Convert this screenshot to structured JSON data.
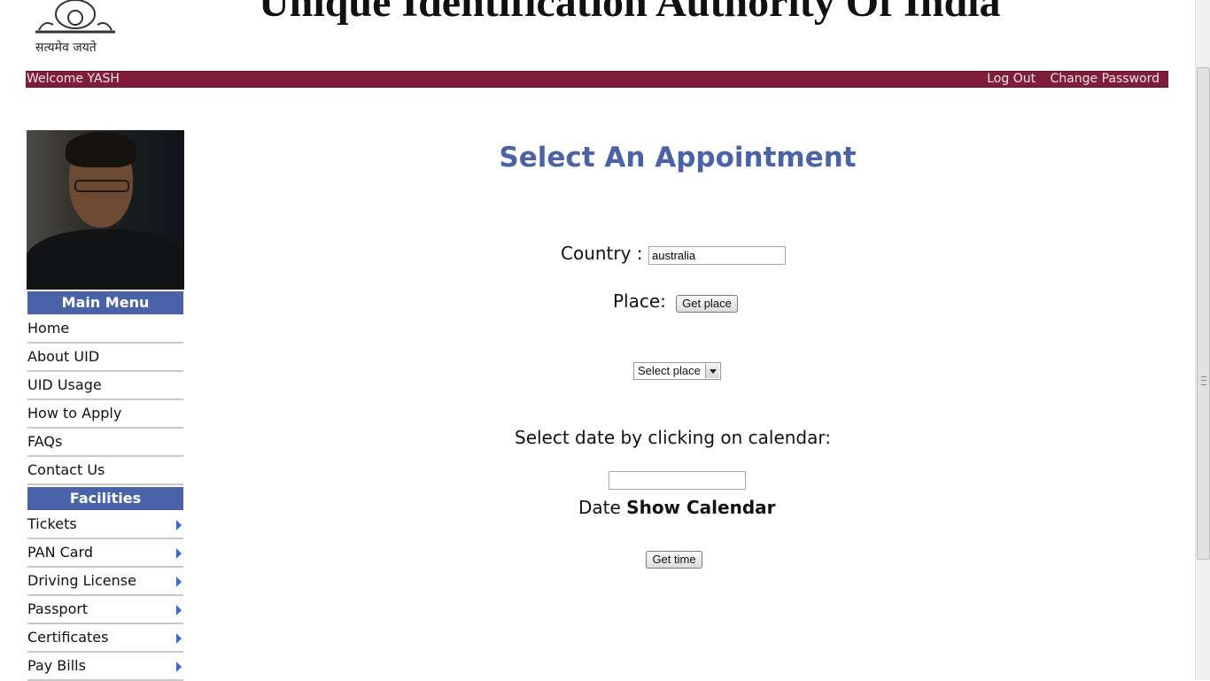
{
  "header": {
    "site_title": "Unique Identification Authority Of India",
    "emblem_motto": "सत्यमेव जयते"
  },
  "topbar": {
    "welcome": "Welcome YASH",
    "logout": "Log Out",
    "change_password": "Change Password",
    "color": "#7f1d3b"
  },
  "sidebar": {
    "main_menu_title": "Main Menu",
    "main_menu": [
      {
        "label": "Home"
      },
      {
        "label": "About UID"
      },
      {
        "label": "UID Usage"
      },
      {
        "label": "How to Apply"
      },
      {
        "label": "FAQs"
      },
      {
        "label": "Contact Us"
      }
    ],
    "facilities_title": "Facilities",
    "facilities": [
      {
        "label": "Tickets",
        "icon": "arrow-right-icon"
      },
      {
        "label": "PAN Card",
        "icon": "arrow-right-icon"
      },
      {
        "label": "Driving License",
        "icon": "arrow-right-icon"
      },
      {
        "label": "Passport",
        "icon": "arrow-right-icon"
      },
      {
        "label": "Certificates",
        "icon": "arrow-right-icon"
      },
      {
        "label": "Pay Bills",
        "icon": "arrow-right-icon"
      }
    ],
    "menu_header_color": "#4a62a8"
  },
  "main": {
    "heading": "Select An Appointment",
    "country_label": "Country :",
    "country_value": "australia",
    "place_label": "Place:",
    "get_place_button": "Get place",
    "place_select_value": "Select place",
    "date_instruction": "Select date by clicking on calendar:",
    "date_value": "",
    "date_label": "Date",
    "show_calendar_link": "Show Calendar",
    "get_time_button": "Get time"
  }
}
